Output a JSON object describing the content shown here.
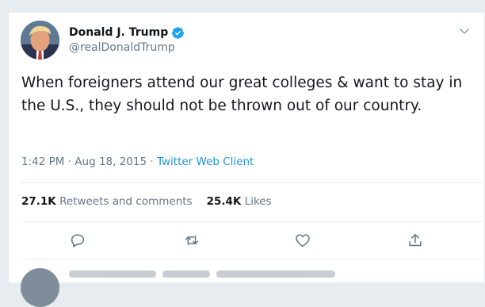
{
  "tweet": {
    "display_name": "Donald J. Trump",
    "handle": "@realDonaldTrump",
    "text": "When foreigners attend our great colleges & want to stay in the U.S., they should not be thrown out of our country.",
    "time": "1:42 PM",
    "separator": "·",
    "date": "Aug 18, 2015",
    "client": "Twitter Web Client"
  },
  "stats": {
    "retweets_count": "27.1K",
    "retweets_label": "Retweets and comments",
    "likes_count": "25.4K",
    "likes_label": "Likes"
  },
  "icons": {
    "verified": "verified-badge-icon",
    "caret": "chevron-down-icon",
    "reply": "reply-icon",
    "retweet": "retweet-icon",
    "like": "heart-icon",
    "share": "share-icon"
  },
  "colors": {
    "link": "#1b95e0",
    "verified": "#1da1f2",
    "secondary_text": "#657786",
    "primary_text": "#14171a",
    "divider": "#e6ecf0"
  }
}
